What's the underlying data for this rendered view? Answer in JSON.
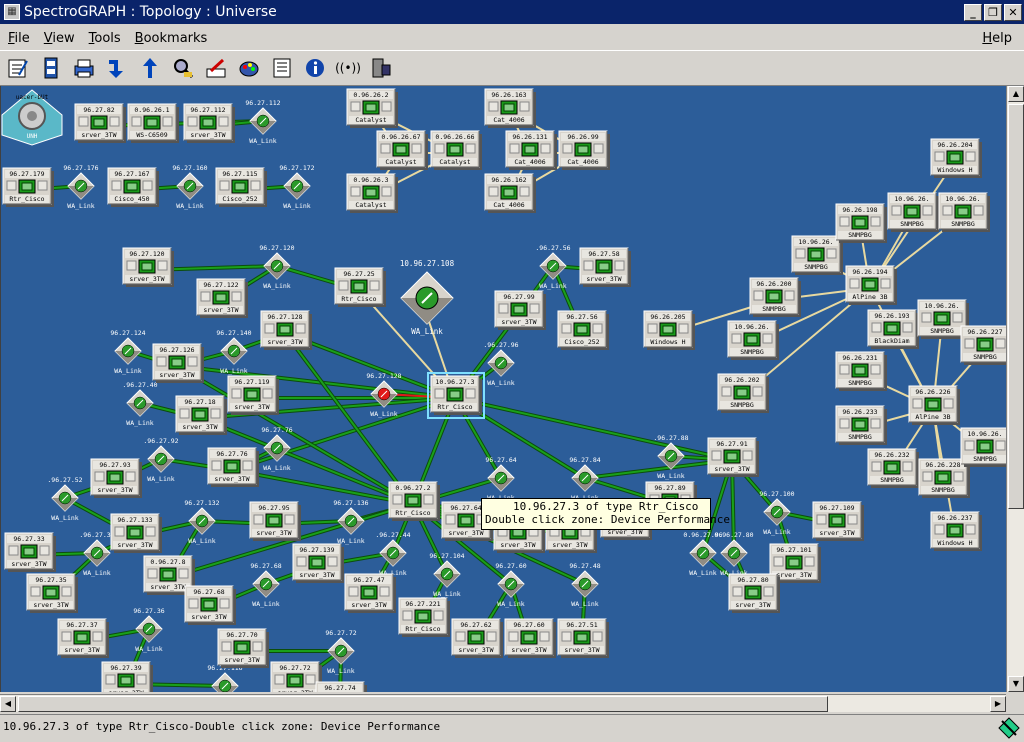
{
  "window": {
    "title": "SpectroGRAPH : Topology : Universe"
  },
  "menu": {
    "file": "File",
    "view": "View",
    "tools": "Tools",
    "bookmarks": "Bookmarks",
    "help": "Help"
  },
  "toolbar": {
    "icons": [
      "notepad-icon",
      "locator-icon",
      "print-icon",
      "go-down-icon",
      "go-up-icon",
      "search-icon",
      "edit-icon",
      "palette-icon",
      "notes-icon",
      "info-icon",
      "alarm-icon",
      "device-icon"
    ]
  },
  "tooltip": {
    "line1": "10.96.27.3 of type Rtr_Cisco",
    "line2": "Double click zone: Device Performance"
  },
  "status": {
    "text": "10.96.27.3 of type Rtr_Cisco-Double click zone: Device Performance"
  },
  "colors": {
    "background": "#2c5d99",
    "link_green": "#1aa01a",
    "link_beige": "#e8d9a0",
    "device_face": "#d8d4cc",
    "selected_border": "#7fdfff",
    "alarm_red": "#e01818"
  },
  "devices": [
    {
      "ip": "96.27.82",
      "type": "srver_3TW"
    },
    {
      "ip": "0.96.26.1",
      "type": "WS-C6509"
    },
    {
      "ip": "96.27.112",
      "type": "srver_3TW"
    },
    {
      "ip": "96.27.179",
      "type": "Rtr_Cisco"
    },
    {
      "ip": "96.27.167",
      "type": "Cisco_450"
    },
    {
      "ip": "96.27.115",
      "type": "Cisco_252"
    },
    {
      "ip": "0.96.26.2",
      "type": "Catalyst"
    },
    {
      "ip": "0.96.26.67",
      "type": "Catalyst"
    },
    {
      "ip": "0.96.26.66",
      "type": "Catalyst"
    },
    {
      "ip": "0.96.26.3",
      "type": "Catalyst"
    },
    {
      "ip": "96.26.163",
      "type": "Cat_4006"
    },
    {
      "ip": "96.26.131",
      "type": "Cat_4006"
    },
    {
      "ip": "96.26.99",
      "type": "Cat_4006"
    },
    {
      "ip": "96.26.162",
      "type": "Cat_4006"
    },
    {
      "ip": "96.27.120",
      "type": "srver_3TW"
    },
    {
      "ip": "96.27.122",
      "type": "srver_3TW"
    },
    {
      "ip": "96.27.25",
      "type": "Rtr_Cisco"
    },
    {
      "ip": "96.27.128",
      "type": "srver_3TW"
    },
    {
      "ip": "96.27.99",
      "type": "srver_3TW"
    },
    {
      "ip": "96.27.58",
      "type": "srver_3TW"
    },
    {
      "ip": "96.27.56",
      "type": "Cisco_252"
    },
    {
      "ip": "96.27.126",
      "type": "srver_3TW"
    },
    {
      "ip": "96.27.119",
      "type": "srver_3TW"
    },
    {
      "ip": "96.27.18",
      "type": "srver_3TW"
    },
    {
      "ip": "10.96.27.3",
      "type": "Rtr_Cisco"
    },
    {
      "ip": "96.27.76",
      "type": "srver_3TW"
    },
    {
      "ip": "96.27.93",
      "type": "srver_3TW"
    },
    {
      "ip": "0.96.27.2",
      "type": "Rtr_Cisco"
    },
    {
      "ip": "96.27.91",
      "type": "srver_3TW"
    },
    {
      "ip": "96.27.89",
      "type": "srver_3TW"
    },
    {
      "ip": "96.27.84",
      "type": "srver_3TW"
    },
    {
      "ip": "96.27.86",
      "type": "srver_3TW"
    },
    {
      "ip": "96.27.66",
      "type": "srver_3TW"
    },
    {
      "ip": "96.27.64",
      "type": "srver_3TW"
    },
    {
      "ip": "96.27.95",
      "type": "srver_3TW"
    },
    {
      "ip": "96.27.133",
      "type": "srver_3TW"
    },
    {
      "ip": "96.27.33",
      "type": "srver_3TW"
    },
    {
      "ip": "96.27.35",
      "type": "srver_3TW"
    },
    {
      "ip": "0.96.27.8",
      "type": "srver_3TW"
    },
    {
      "ip": "96.27.139",
      "type": "srver_3TW"
    },
    {
      "ip": "96.27.47",
      "type": "srver_3TW"
    },
    {
      "ip": "96.27.68",
      "type": "srver_3TW"
    },
    {
      "ip": "96.27.37",
      "type": "srver_3TW"
    },
    {
      "ip": "96.27.70",
      "type": "srver_3TW"
    },
    {
      "ip": "96.27.221",
      "type": "Rtr_Cisco"
    },
    {
      "ip": "96.27.62",
      "type": "srver_3TW"
    },
    {
      "ip": "96.27.60",
      "type": "srver_3TW"
    },
    {
      "ip": "96.27.51",
      "type": "srver_3TW"
    },
    {
      "ip": "96.27.39",
      "type": "srver_3TW"
    },
    {
      "ip": "96.27.72",
      "type": "srver_3TW"
    },
    {
      "ip": "96.27.74",
      "type": "srver_3TW"
    },
    {
      "ip": "96.27.109",
      "type": "srver_3TW"
    },
    {
      "ip": "96.27.101",
      "type": "srver_3TW"
    },
    {
      "ip": "96.27.80",
      "type": "srver_3TW"
    },
    {
      "ip": "96.26.205",
      "type": "Windows H"
    },
    {
      "ip": "10.96.26.",
      "type": "SNMPBG"
    },
    {
      "ip": "96.26.200",
      "type": "SNMPBG"
    },
    {
      "ip": "10.96.26.",
      "type": "SNMPBG"
    },
    {
      "ip": "96.26.198",
      "type": "SNMPBG"
    },
    {
      "ip": "10.96.26.",
      "type": "SNMPBG"
    },
    {
      "ip": "10.96.26.",
      "type": "SNMPBG"
    },
    {
      "ip": "96.26.194",
      "type": "AlPine 3B"
    },
    {
      "ip": "96.26.204",
      "type": "Windows H"
    },
    {
      "ip": "96.26.193",
      "type": "BlackDiam"
    },
    {
      "ip": "10.96.26.",
      "type": "SNMPBG"
    },
    {
      "ip": "96.26.202",
      "type": "SNMPBG"
    },
    {
      "ip": "96.26.231",
      "type": "SNMPBG"
    },
    {
      "ip": "96.26.226",
      "type": "AlPine 3B"
    },
    {
      "ip": "96.26.233",
      "type": "SNMPBG"
    },
    {
      "ip": "96.26.232",
      "type": "SNMPBG"
    },
    {
      "ip": "96.26.228",
      "type": "SNMPBG"
    },
    {
      "ip": "96.26.227",
      "type": "SNMPBG"
    },
    {
      "ip": "10.96.26.",
      "type": "SNMPBG"
    },
    {
      "ip": "96.26.237",
      "type": "Windows H"
    },
    {
      "ip": "10.96.27.108",
      "type": "WA_Link"
    }
  ],
  "wa_link": {
    "label": "WA_Link"
  },
  "wa_links": [
    {
      "ip": "96.27.112"
    },
    {
      "ip": "96.27.176"
    },
    {
      "ip": "96.27.160"
    },
    {
      "ip": "96.27.172"
    },
    {
      "ip": "96.27.120"
    },
    {
      "ip": ".96.27.56"
    },
    {
      "ip": "96.27.124"
    },
    {
      "ip": "96.27.140"
    },
    {
      "ip": ".96.27.40"
    },
    {
      "ip": "96.27.128"
    },
    {
      "ip": ".96.27.96"
    },
    {
      "ip": ".96.27.92"
    },
    {
      "ip": "96.27.76"
    },
    {
      "ip": "96.27.64"
    },
    {
      "ip": "96.27.84"
    },
    {
      "ip": ".96.27.52"
    },
    {
      "ip": "96.27.132"
    },
    {
      "ip": "96.27.136"
    },
    {
      "ip": ".96.27.32"
    },
    {
      "ip": ".96.27.44"
    },
    {
      "ip": "96.27.104"
    },
    {
      "ip": "96.27.60"
    },
    {
      "ip": "96.27.48"
    },
    {
      "ip": ".96.27.88"
    },
    {
      "ip": "96.27.100"
    },
    {
      "ip": "0.96.27.96"
    },
    {
      "ip": "0.96.27.80"
    },
    {
      "ip": "96.27.68"
    },
    {
      "ip": "96.27.36"
    },
    {
      "ip": "96.27.72"
    },
    {
      "ip": "96.27.116"
    },
    {
      "ip": "uacer-bUt"
    }
  ]
}
